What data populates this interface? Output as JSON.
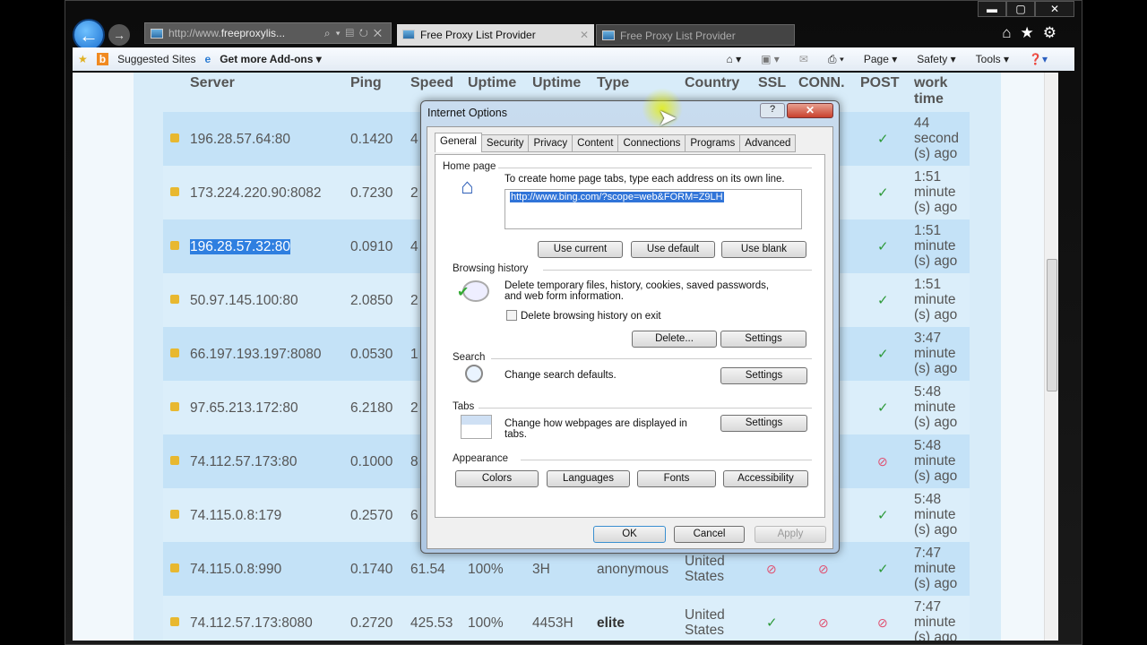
{
  "browser": {
    "address": "http://www.freeproxylis...",
    "address_host": "freeproxylis...",
    "address_prefix": "http://www.",
    "tabs": [
      {
        "label": "Free Proxy List Provider"
      },
      {
        "label": "Free Proxy List Provider"
      }
    ],
    "favorites": {
      "suggested": "Suggested Sites",
      "addons": "Get more Add-ons ▾"
    },
    "commands": {
      "page": "Page ▾",
      "safety": "Safety ▾",
      "tools": "Tools ▾"
    }
  },
  "table": {
    "headers": {
      "server": "Server",
      "ping": "Ping",
      "speed": "Speed",
      "uptime": "Uptime",
      "uptime2": "Uptime",
      "type": "Type",
      "country": "Country",
      "ssl": "SSL",
      "conn": "CONN.",
      "post": "POST",
      "work": "work",
      "time": "time"
    },
    "rows": [
      {
        "server": "196.28.57.64:80",
        "ping": "0.1420",
        "speed": "4",
        "post": "yes",
        "w1": "44",
        "w2": "second",
        "w3": "(s) ago"
      },
      {
        "server": "173.224.220.90:8082",
        "ping": "0.7230",
        "speed": "2",
        "post": "yes",
        "w1": "1:51",
        "w2": "minute",
        "w3": "(s) ago"
      },
      {
        "server": "196.28.57.32:80",
        "ping": "0.0910",
        "speed": "4",
        "post": "yes",
        "w1": "1:51",
        "w2": "minute",
        "w3": "(s) ago",
        "selected": true
      },
      {
        "server": "50.97.145.100:80",
        "ping": "2.0850",
        "speed": "2",
        "post": "yes",
        "w1": "1:51",
        "w2": "minute",
        "w3": "(s) ago"
      },
      {
        "server": "66.197.193.197:8080",
        "ping": "0.0530",
        "speed": "1",
        "post": "yes",
        "w1": "3:47",
        "w2": "minute",
        "w3": "(s) ago"
      },
      {
        "server": "97.65.213.172:80",
        "ping": "6.2180",
        "speed": "2",
        "post": "yes",
        "w1": "5:48",
        "w2": "minute",
        "w3": "(s) ago"
      },
      {
        "server": "74.112.57.173:80",
        "ping": "0.1000",
        "speed": "8",
        "post": "no",
        "w1": "5:48",
        "w2": "minute",
        "w3": "(s) ago"
      },
      {
        "server": "74.115.0.8:179",
        "ping": "0.2570",
        "speed": "6",
        "post": "yes",
        "w1": "5:48",
        "w2": "minute",
        "w3": "(s) ago"
      },
      {
        "server": "74.115.0.8:990",
        "ping": "0.1740",
        "speed": "61.54",
        "uptime": "100%",
        "uptime2": "3H",
        "type": "anonymous",
        "country1": "United",
        "country2": "States",
        "ssl": "no",
        "conn": "no",
        "post": "yes",
        "w1": "7:47",
        "w2": "minute",
        "w3": "(s) ago"
      },
      {
        "server": "74.112.57.173:8080",
        "ping": "0.2720",
        "speed": "425.53",
        "uptime": "100%",
        "uptime2": "4453H",
        "type": "elite",
        "country1": "United",
        "country2": "States",
        "ssl": "yes",
        "conn": "no",
        "post": "no",
        "w1": "7:47",
        "w2": "minute",
        "w3": "(s) ago"
      }
    ]
  },
  "dialog": {
    "title": "Internet Options",
    "help": "?",
    "tabs": [
      "General",
      "Security",
      "Privacy",
      "Content",
      "Connections",
      "Programs",
      "Advanced"
    ],
    "home_group": "Home page",
    "home_text": "To create home page tabs, type each address on its own line.",
    "home_url": "http://www.bing.com/?scope=web&FORM=Z9LH",
    "use_current": "Use current",
    "use_default": "Use default",
    "use_blank": "Use blank",
    "history_group": "Browsing history",
    "history_text1": "Delete temporary files, history, cookies, saved passwords,",
    "history_text2": "and web form information.",
    "history_checkbox": "Delete browsing history on exit",
    "delete": "Delete...",
    "settings": "Settings",
    "search_group": "Search",
    "search_text": "Change search defaults.",
    "tabs_group": "Tabs",
    "tabs_text1": "Change how webpages are displayed in",
    "tabs_text2": "tabs.",
    "appearance_group": "Appearance",
    "colors": "Colors",
    "languages": "Languages",
    "fonts": "Fonts",
    "accessibility": "Accessibility",
    "ok": "OK",
    "cancel": "Cancel",
    "apply": "Apply"
  }
}
